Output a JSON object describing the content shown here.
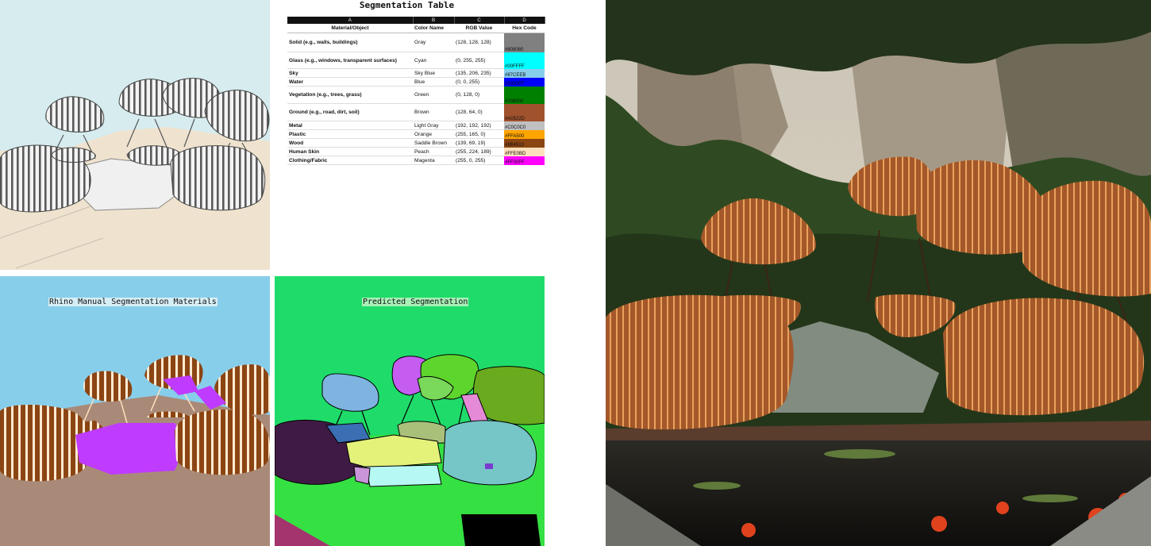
{
  "segmentation_table": {
    "title": "Segmentation Table",
    "column_letters": [
      "A",
      "B",
      "C",
      "D"
    ],
    "headers": [
      "Material/Object",
      "Color Name",
      "RGB Value",
      "Hex Code"
    ],
    "rows": [
      {
        "material": "Solid (e.g., walls, buildings)",
        "color_name": "Gray",
        "rgb": "(128, 128, 128)",
        "hex": "#808080",
        "swatch": "#808080"
      },
      {
        "material": "Glass (e.g., windows, transparent surfaces)",
        "color_name": "Cyan",
        "rgb": "(0, 255, 255)",
        "hex": "#00FFFF",
        "swatch": "#00FFFF"
      },
      {
        "material": "Sky",
        "color_name": "Sky Blue",
        "rgb": "(135, 206, 235)",
        "hex": "#87CEEB",
        "swatch": "#87CEEB"
      },
      {
        "material": "Water",
        "color_name": "Blue",
        "rgb": "(0, 0, 255)",
        "hex": "#0000FF",
        "swatch": "#0000FF"
      },
      {
        "material": "Vegetation (e.g., trees, grass)",
        "color_name": "Green",
        "rgb": "(0, 128, 0)",
        "hex": "#008000",
        "swatch": "#008000"
      },
      {
        "material": "Ground (e.g., road, dirt, soil)",
        "color_name": "Brown",
        "rgb": "(128, 64, 0)",
        "hex": "#A0522D",
        "swatch": "#A0522D"
      },
      {
        "material": "Metal",
        "color_name": "Light Gray",
        "rgb": "(192, 192, 192)",
        "hex": "#C0C0C0",
        "swatch": "#C0C0C0"
      },
      {
        "material": "Plastic",
        "color_name": "Orange",
        "rgb": "(255, 165, 0)",
        "hex": "#FFA500",
        "swatch": "#FFA500"
      },
      {
        "material": "Wood",
        "color_name": "Saddle Brown",
        "rgb": "(139, 69, 19)",
        "hex": "#8B4513",
        "swatch": "#8B4513"
      },
      {
        "material": "Human Skin",
        "color_name": "Peach",
        "rgb": "(255, 224, 189)",
        "hex": "#FFE0BD",
        "swatch": "#FFE0BD"
      },
      {
        "material": "Clothing/Fabric",
        "color_name": "Magenta",
        "rgb": "(255, 0, 255)",
        "hex": "#FF00FF",
        "swatch": "#FF00FF"
      }
    ]
  },
  "rhino_panel": {
    "caption": "Rhino Manual Segmentation Materials"
  },
  "predicted_panel": {
    "caption": "Predicted Segmentation"
  },
  "colors": {
    "render_sky": "#d6ecef",
    "render_ground": "#efe3cf",
    "seg_sky": "#87CEEB",
    "seg_ground": "#a98a78",
    "seg_wood": "#8B4513",
    "seg_clothing": "#bf3bff",
    "pred_background": "#1fdc6a"
  }
}
